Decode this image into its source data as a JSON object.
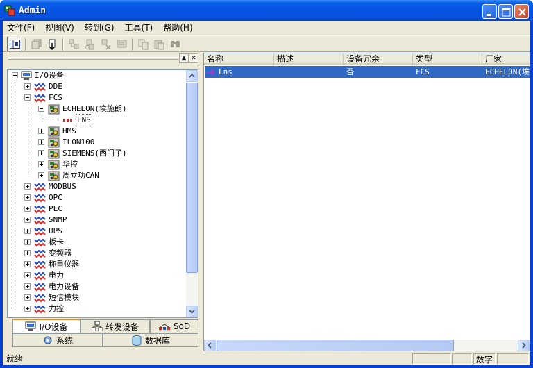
{
  "window": {
    "title": "Admin"
  },
  "menu": [
    {
      "label": "文件(F)"
    },
    {
      "label": "视图(V)"
    },
    {
      "label": "转到(G)"
    },
    {
      "label": "工具(T)"
    },
    {
      "label": "帮助(H)"
    }
  ],
  "toolbar": [
    {
      "icon": "panel-toggle-icon",
      "state": "pressed"
    },
    {
      "icon": "new-window-icon",
      "state": "disabled"
    },
    {
      "icon": "jump-icon",
      "state": "enabled"
    },
    {
      "icon": "add-node-icon",
      "state": "disabled"
    },
    {
      "icon": "add-child-icon",
      "state": "disabled"
    },
    {
      "icon": "delete-node-icon",
      "state": "disabled"
    },
    {
      "icon": "properties-icon",
      "state": "disabled"
    },
    {
      "icon": "copy-icon",
      "state": "disabled"
    },
    {
      "icon": "paste-icon",
      "state": "disabled"
    },
    {
      "icon": "find-icon",
      "state": "disabled"
    }
  ],
  "tree": {
    "root": "I/O设备",
    "items": [
      {
        "label": "DDE",
        "level": 1,
        "expander": "plus",
        "icon": "channel-icon"
      },
      {
        "label": "FCS",
        "level": 1,
        "expander": "minus",
        "icon": "channel-icon"
      },
      {
        "label": "ECHELON(埃施朗)",
        "level": 2,
        "expander": "minus",
        "icon": "device-folder-icon"
      },
      {
        "label": "LNS",
        "level": 3,
        "expander": "none",
        "icon": "driver-icon",
        "selected": true
      },
      {
        "label": "HMS",
        "level": 2,
        "expander": "plus",
        "icon": "device-folder-icon"
      },
      {
        "label": "ILON100",
        "level": 2,
        "expander": "plus",
        "icon": "device-folder-icon"
      },
      {
        "label": "SIEMENS(西门子)",
        "level": 2,
        "expander": "plus",
        "icon": "device-folder-icon"
      },
      {
        "label": "华控",
        "level": 2,
        "expander": "plus",
        "icon": "device-folder-icon"
      },
      {
        "label": "周立功CAN",
        "level": 2,
        "expander": "plus",
        "icon": "device-folder-icon"
      },
      {
        "label": "MODBUS",
        "level": 1,
        "expander": "plus",
        "icon": "channel-icon"
      },
      {
        "label": "OPC",
        "level": 1,
        "expander": "plus",
        "icon": "channel-icon"
      },
      {
        "label": "PLC",
        "level": 1,
        "expander": "plus",
        "icon": "channel-icon"
      },
      {
        "label": "SNMP",
        "level": 1,
        "expander": "plus",
        "icon": "channel-icon"
      },
      {
        "label": "UPS",
        "level": 1,
        "expander": "plus",
        "icon": "channel-icon"
      },
      {
        "label": "板卡",
        "level": 1,
        "expander": "plus",
        "icon": "channel-icon"
      },
      {
        "label": "变频器",
        "level": 1,
        "expander": "plus",
        "icon": "channel-icon"
      },
      {
        "label": "称重仪器",
        "level": 1,
        "expander": "plus",
        "icon": "channel-icon"
      },
      {
        "label": "电力",
        "level": 1,
        "expander": "plus",
        "icon": "channel-icon"
      },
      {
        "label": "电力设备",
        "level": 1,
        "expander": "plus",
        "icon": "channel-icon"
      },
      {
        "label": "短信模块",
        "level": 1,
        "expander": "plus",
        "icon": "channel-icon"
      },
      {
        "label": "力控",
        "level": 1,
        "expander": "plus",
        "icon": "channel-icon"
      }
    ]
  },
  "tabs": {
    "row1": [
      {
        "label": "I/O设备",
        "icon": "computer-icon",
        "active": true
      },
      {
        "label": "转发设备",
        "icon": "network-icon",
        "active": false
      },
      {
        "label": "SoD",
        "icon": "sod-icon",
        "active": false
      }
    ],
    "row2": [
      {
        "label": "系统",
        "icon": "system-icon"
      },
      {
        "label": "数据库",
        "icon": "database-icon"
      }
    ]
  },
  "list": {
    "columns": [
      "名称",
      "描述",
      "设备冗余",
      "类型",
      "厂家"
    ],
    "rows": [
      {
        "name": "Lns",
        "description": "",
        "redundancy": "否",
        "type": "FCS",
        "vendor": "ECHELON(埃施朗)"
      }
    ]
  },
  "status": {
    "text": "就绪",
    "mode": "数字"
  },
  "colors": {
    "selection": "#316ac5",
    "titlebar": "#0554e3",
    "face": "#ece9d8",
    "tab_accent": "#e68b2c"
  }
}
